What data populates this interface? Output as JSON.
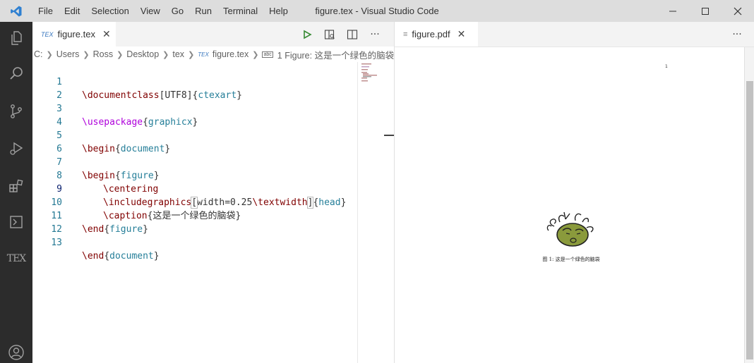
{
  "window": {
    "title": "figure.tex - Visual Studio Code",
    "menu": [
      "File",
      "Edit",
      "Selection",
      "View",
      "Go",
      "Run",
      "Terminal",
      "Help"
    ]
  },
  "activitybar": {
    "items": [
      "explorer",
      "search",
      "source-control",
      "run-debug",
      "extensions",
      "remote",
      "tex"
    ],
    "tex_label": "TEX"
  },
  "editor1": {
    "tab": {
      "icon": "TEX",
      "label": "figure.tex"
    },
    "breadcrumb": [
      "C:",
      "Users",
      "Ross",
      "Desktop",
      "tex",
      "figure.tex",
      "1 Figure:  这是一个绿色的脑袋"
    ],
    "lines": [
      {
        "n": "1"
      },
      {
        "n": "2"
      },
      {
        "n": "3"
      },
      {
        "n": "4"
      },
      {
        "n": "5"
      },
      {
        "n": "6"
      },
      {
        "n": "7"
      },
      {
        "n": "8"
      },
      {
        "n": "9"
      },
      {
        "n": "10"
      },
      {
        "n": "11"
      },
      {
        "n": "12"
      },
      {
        "n": "13"
      }
    ],
    "code": {
      "l1": [
        "\\documentclass",
        "[UTF8]",
        "{",
        "ctexart",
        "}"
      ],
      "l3": [
        "\\usepackage",
        "{",
        "graphicx",
        "}"
      ],
      "l5": [
        "\\begin",
        "{",
        "document",
        "}"
      ],
      "l7": [
        "\\begin",
        "{",
        "figure",
        "}"
      ],
      "l8": [
        "\\centering"
      ],
      "l9": [
        "\\includegraphics",
        "[",
        "width=0.25",
        "\\textwidth",
        "]",
        "{",
        "head",
        "}"
      ],
      "l10": [
        "\\caption",
        "{这是一个绿色的脑袋}"
      ],
      "l11": [
        "\\end",
        "{",
        "figure",
        "}"
      ],
      "l13": [
        "\\end",
        "{",
        "document",
        "}"
      ]
    }
  },
  "editor2": {
    "tab": {
      "label": "figure.pdf"
    },
    "pdf": {
      "page_number": "1",
      "caption": "图 1: 这是一个绿色的脑袋"
    }
  },
  "colors": {
    "titlebar": "#dddddd",
    "activitybar": "#2c2c2c",
    "line_number": "#237893",
    "keyword": "#800000",
    "argument": "#267f99"
  }
}
